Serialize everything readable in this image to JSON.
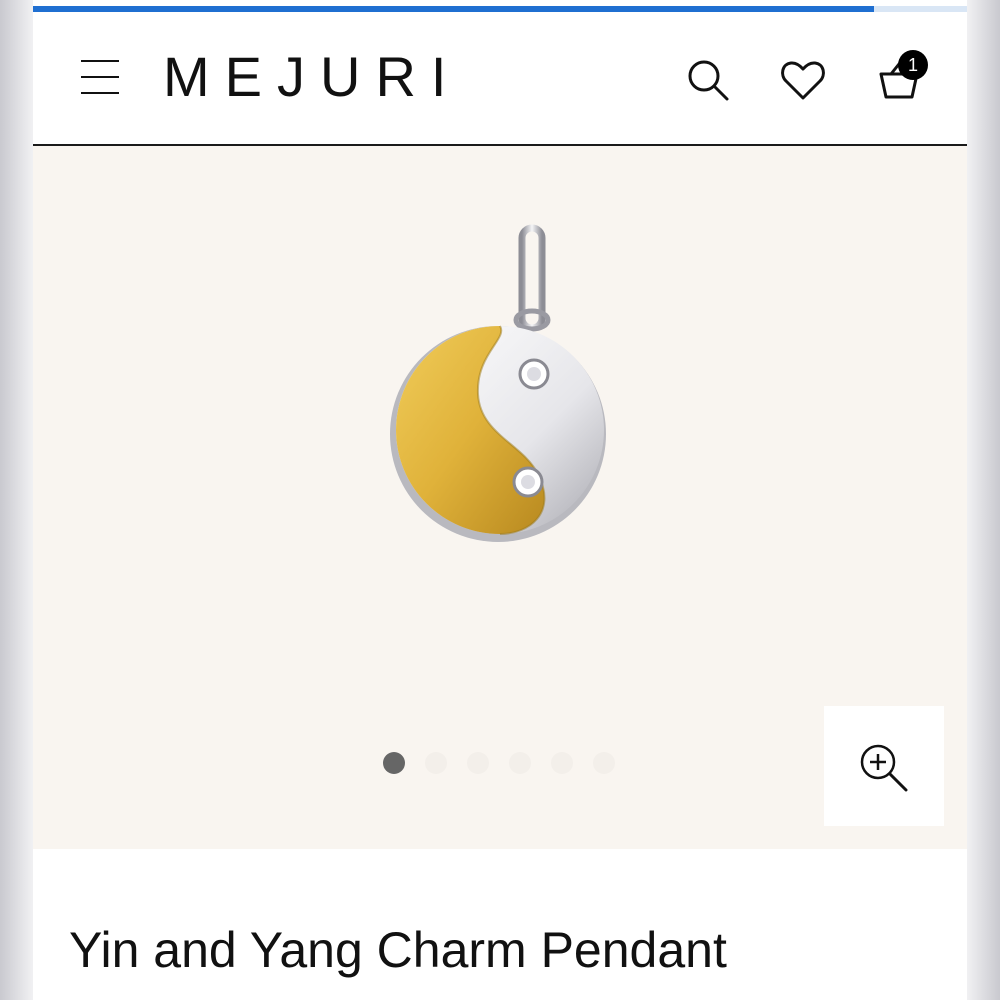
{
  "header": {
    "logo": "MEJURI",
    "cart_count": "1",
    "icons": [
      "menu-icon",
      "search-icon",
      "heart-icon",
      "shopping-bag-icon"
    ]
  },
  "page_load_progress": 0.9,
  "gallery": {
    "image_name": "yin-yang-pendant-image",
    "slide_count": 6,
    "active_slide": 1,
    "zoom_icon": "zoom-in-icon"
  },
  "product": {
    "title": "Yin and Yang Charm Pendant"
  },
  "colors": {
    "accent_blue": "#1f6fd1",
    "gallery_bg": "#f9f5f0",
    "gold": "#e0b23a",
    "silver": "#e4e4e8"
  }
}
